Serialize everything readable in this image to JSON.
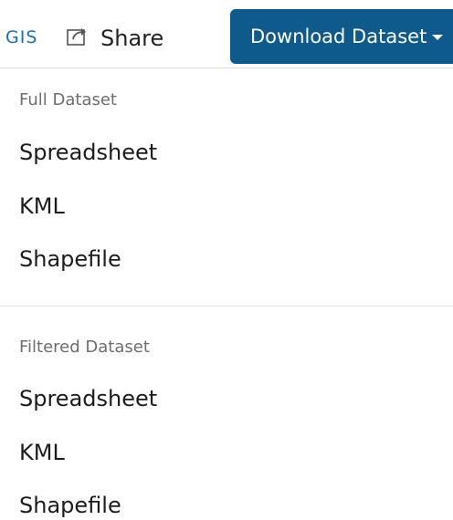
{
  "toolbar": {
    "gis_link": "GIS",
    "share_label": "Share",
    "download_label": "Download Dataset"
  },
  "menu": {
    "sections": [
      {
        "header": "Full Dataset",
        "items": [
          "Spreadsheet",
          "KML",
          "Shapefile"
        ]
      },
      {
        "header": "Filtered Dataset",
        "items": [
          "Spreadsheet",
          "KML",
          "Shapefile"
        ]
      }
    ]
  },
  "colors": {
    "accent": "#0f5a8c",
    "link": "#1f6fb2"
  }
}
